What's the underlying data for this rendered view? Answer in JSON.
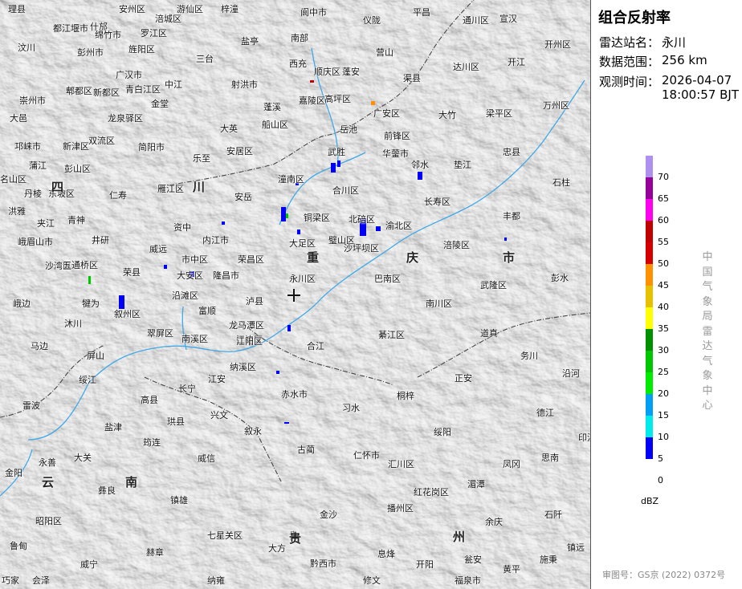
{
  "panel": {
    "title": "组合反射率",
    "station_label": "雷达站名：",
    "station_value": "永川",
    "range_label": "数据范围：",
    "range_value": "256 km",
    "time_label": "观测时间：",
    "time_date": "2026-04-07",
    "time_clock": "18:00:57 BJT",
    "unit": "dBZ",
    "org": "中国气象局雷达气象中心",
    "approval": "审图号：GS京 (2022) 0372号"
  },
  "colorbar": [
    {
      "label": "70",
      "color": "#ad90f0"
    },
    {
      "label": "65",
      "color": "#96009b"
    },
    {
      "label": "60",
      "color": "#ff00f0"
    },
    {
      "label": "55",
      "color": "#c10000"
    },
    {
      "label": "50",
      "color": "#d60000"
    },
    {
      "label": "45",
      "color": "#ff9000"
    },
    {
      "label": "40",
      "color": "#e7c000"
    },
    {
      "label": "35",
      "color": "#ffff00"
    },
    {
      "label": "30",
      "color": "#009000"
    },
    {
      "label": "25",
      "color": "#00c800"
    },
    {
      "label": "20",
      "color": "#00ec00"
    },
    {
      "label": "15",
      "color": "#01a0f6"
    },
    {
      "label": "10",
      "color": "#00ecec"
    },
    {
      "label": "5",
      "color": "#0000f6"
    },
    {
      "label": "0",
      "color": "#0000f6"
    }
  ],
  "map": {
    "radar_site": "永川区",
    "provinces": [
      "四",
      "川",
      "重",
      "庆",
      "市",
      "云",
      "南",
      "贵",
      "州"
    ],
    "places": [
      "理县",
      "安州区",
      "游仙区",
      "梓潼",
      "阆中市",
      "仪陇",
      "平昌",
      "宣汉",
      "通川区",
      "开州区",
      "汶川",
      "什邡",
      "绵竹市",
      "涪城区",
      "盐亭",
      "南部",
      "营山",
      "渠县",
      "达川区",
      "开江",
      "万州区",
      "都江堰市",
      "彭州市",
      "罗江区",
      "旌阳区",
      "三台",
      "西充",
      "顺庆区",
      "蓬安",
      "梁平区",
      "忠县",
      "郫都区",
      "新都区",
      "广汉市",
      "中江",
      "射洪市",
      "嘉陵区",
      "高坪区",
      "广安区",
      "大竹",
      "垫江",
      "崇州市",
      "青白江区",
      "金堂",
      "蓬溪",
      "船山区",
      "岳池",
      "前锋区",
      "邻水",
      "石柱",
      "大邑",
      "龙泉驿区",
      "双流区",
      "简阳市",
      "大英",
      "安居区",
      "武胜",
      "华蓥市",
      "长寿区",
      "丰都",
      "邛崃市",
      "新津区",
      "乐至",
      "潼南区",
      "合川区",
      "北碚区",
      "渝北区",
      "涪陵区",
      "名山区",
      "蒲江",
      "彭山区",
      "雁江区",
      "安岳",
      "铜梁区",
      "璧山区",
      "沙坪坝区",
      "巴南区",
      "丹棱",
      "东坡区",
      "仁寿",
      "资中",
      "大足区",
      "荣昌区",
      "武隆区",
      "彭水",
      "洪雅",
      "夹江",
      "青神",
      "井研",
      "威远",
      "内江市",
      "市中区",
      "隆昌市",
      "永川区",
      "南川区",
      "峨眉山市",
      "沙湾区",
      "五通桥区",
      "荣县",
      "大安区",
      "沿滩区",
      "泸县",
      "江津区",
      "道真",
      "务川",
      "峨边",
      "犍为",
      "叙州区",
      "富顺",
      "龙马潭区",
      "綦江区",
      "正安",
      "沿河",
      "马边",
      "沐川",
      "翠屏区",
      "南溪区",
      "江阳区",
      "合江",
      "桐梓",
      "德江",
      "屏山",
      "绥江",
      "长宁",
      "江安",
      "纳溪区",
      "赤水市",
      "习水",
      "绥阳",
      "印江",
      "雷波",
      "高县",
      "珙县",
      "兴文",
      "叙永",
      "古蔺",
      "凤冈",
      "思南",
      "盐津",
      "筠连",
      "威信",
      "仁怀市",
      "汇川区",
      "湄潭",
      "永善",
      "大关",
      "红花岗区",
      "石阡",
      "金阳",
      "彝良",
      "镇雄",
      "金沙",
      "播州区",
      "余庆",
      "昭阳区",
      "七星关区",
      "大方",
      "贵",
      "鲁甸",
      "赫章",
      "黔西市",
      "息烽",
      "开阳",
      "瓮安",
      "施秉",
      "镇远",
      "巧家",
      "会泽",
      "威宁",
      "纳雍",
      "修文",
      "福泉市",
      "黄平"
    ]
  }
}
